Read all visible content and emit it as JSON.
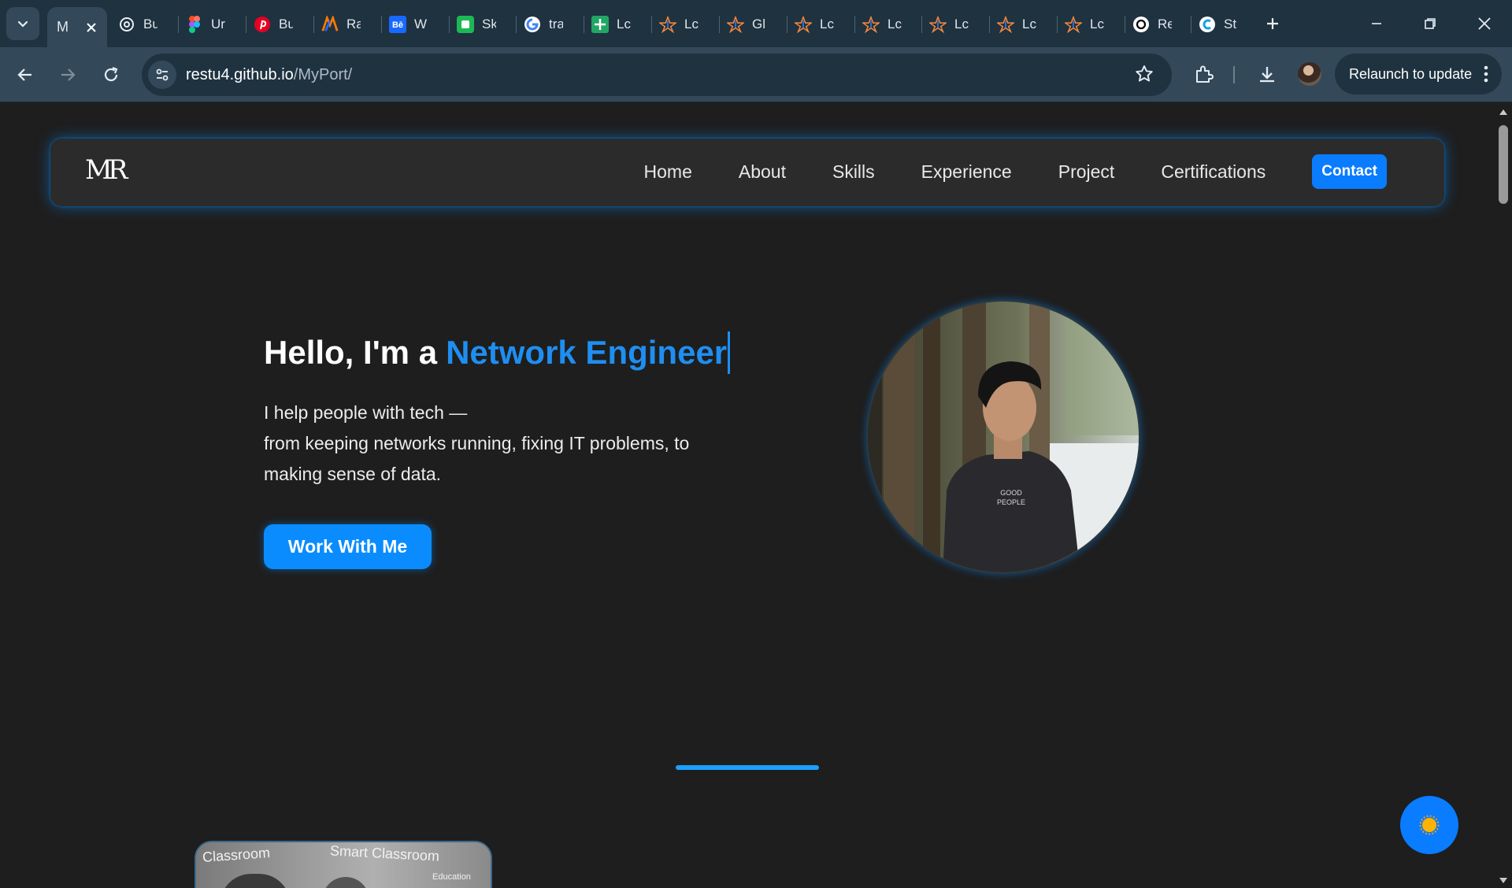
{
  "browser": {
    "tabs": [
      {
        "title": "M",
        "icon": "portfolio-tab-icon",
        "active": true
      },
      {
        "title": "Bu",
        "icon": "chatgpt-icon"
      },
      {
        "title": "Ur",
        "icon": "figma-icon"
      },
      {
        "title": "Bu",
        "icon": "pinterest-icon"
      },
      {
        "title": "Ra",
        "icon": "raw-logo-icon"
      },
      {
        "title": "W",
        "icon": "behance-icon"
      },
      {
        "title": "Sk",
        "icon": "green-app-icon"
      },
      {
        "title": "tra",
        "icon": "google-icon"
      },
      {
        "title": "Lc",
        "icon": "plus-square-icon"
      },
      {
        "title": "Lc",
        "icon": "star-logo-icon"
      },
      {
        "title": "Gl",
        "icon": "star-logo-icon"
      },
      {
        "title": "Lc",
        "icon": "star-logo-icon"
      },
      {
        "title": "Lc",
        "icon": "star-logo-icon"
      },
      {
        "title": "Lc",
        "icon": "star-logo-icon"
      },
      {
        "title": "Lc",
        "icon": "star-logo-icon"
      },
      {
        "title": "Lc",
        "icon": "star-logo-icon"
      },
      {
        "title": "Re",
        "icon": "openai-icon"
      },
      {
        "title": "St",
        "icon": "c-logo-icon"
      }
    ],
    "url_host": "restu4.github.io",
    "url_path": "/MyPort/",
    "relaunch_label": "Relaunch to update"
  },
  "site": {
    "logo": "MR",
    "nav": {
      "items": [
        "Home",
        "About",
        "Skills",
        "Experience",
        "Project",
        "Certifications"
      ],
      "contact": "Contact"
    },
    "hero": {
      "greeting": "Hello, I'm a",
      "role": "Network Engineer",
      "lines": [
        "I help people with tech —",
        "from keeping networks running, fixing IT problems, to",
        "making sense of data."
      ],
      "cta": "Work With Me"
    },
    "portrait_shirt_text": [
      "GOOD",
      "PEOPLE"
    ],
    "project_photo_text": [
      "Classroom",
      "Smart Classroom",
      "Education"
    ]
  },
  "colors": {
    "accent": "#0a8cff",
    "heading_accent": "#1f8ef1",
    "page_bg": "#1e1e1e",
    "nav_bg": "#2b2b2b",
    "browser_chrome": "#1f3240"
  }
}
